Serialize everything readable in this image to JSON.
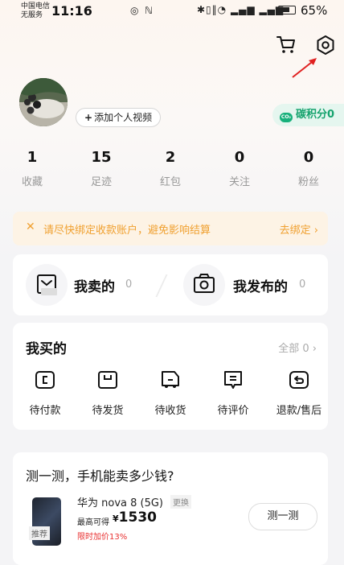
{
  "status_bar": {
    "carrier_line1": "中国电信",
    "carrier_line2": "无服务",
    "time": "11:16",
    "battery": "65%"
  },
  "header": {
    "cart_icon": "cart-icon",
    "settings_icon": "gear-icon",
    "annotation_arrow_color": "#e02020"
  },
  "profile": {
    "add_video_label": "添加个人视频",
    "carbon_label": "碳积分0"
  },
  "stats": [
    {
      "value": "1",
      "label": "收藏"
    },
    {
      "value": "15",
      "label": "足迹"
    },
    {
      "value": "2",
      "label": "红包"
    },
    {
      "value": "0",
      "label": "关注"
    },
    {
      "value": "0",
      "label": "粉丝"
    }
  ],
  "notice": {
    "text": "请尽快绑定收款账户，避免影响结算",
    "action": "去绑定"
  },
  "sell": {
    "sold_label": "我卖的",
    "sold_count": "0",
    "published_label": "我发布的",
    "published_count": "0"
  },
  "buy": {
    "title": "我买的",
    "all_label": "全部",
    "all_count": "0",
    "items": [
      {
        "label": "待付款",
        "icon": "wallet-icon"
      },
      {
        "label": "待发货",
        "icon": "package-icon"
      },
      {
        "label": "待收货",
        "icon": "truck-icon"
      },
      {
        "label": "待评价",
        "icon": "comment-icon"
      },
      {
        "label": "退款/售后",
        "icon": "return-icon"
      }
    ]
  },
  "phone_card": {
    "question": "测一测，手机能卖多少钱?",
    "badge": "推荐",
    "model": "华为 nova 8 (5G)",
    "change": "更换",
    "max_label": "最高可得",
    "currency": "¥",
    "price": "1530",
    "promo": "限时加价13%",
    "test_button": "测一测"
  },
  "colors": {
    "accent_orange": "#f0a030",
    "carbon_green": "#16a36e",
    "promo_red": "#e83030"
  }
}
